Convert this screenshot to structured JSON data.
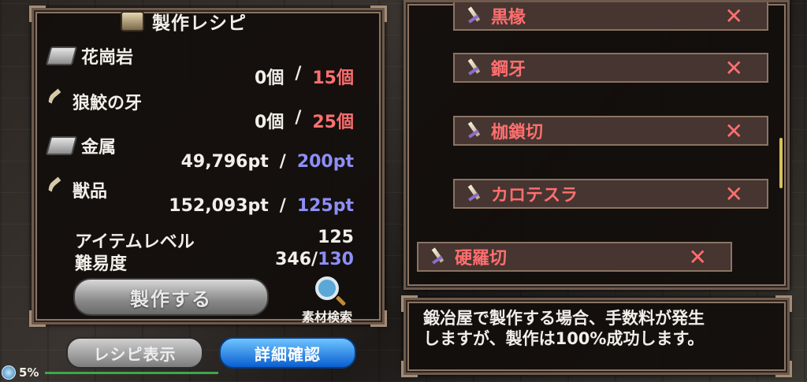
{
  "recipe": {
    "title": "製作レシピ",
    "materials": [
      {
        "name": "花崗岩",
        "icon": "ingot-icon",
        "have": "0個",
        "sep": "/",
        "need": "15個",
        "need_color": "red"
      },
      {
        "name": "狼鮫の牙",
        "icon": "fang-icon",
        "have": "0個",
        "sep": "/",
        "need": "25個",
        "need_color": "red"
      },
      {
        "name": "金属",
        "icon": "ingot-icon",
        "have": "49,796pt",
        "sep": "/",
        "need": "200pt",
        "need_color": "blue"
      },
      {
        "name": "獣品",
        "icon": "fang-icon",
        "have": "152,093pt",
        "sep": "/",
        "need": "125pt",
        "need_color": "blue"
      }
    ],
    "item_level_label": "アイテムレベル",
    "item_level_value": "125",
    "difficulty_label": "難易度",
    "difficulty_value": "346/",
    "difficulty_req": "130",
    "craft_button": "製作する",
    "search_label": "素材検索"
  },
  "bottom_buttons": {
    "recipe_display": "レシピ表示",
    "detail_confirm": "詳細確認"
  },
  "list": {
    "items": [
      {
        "name": "黒椽",
        "mark": "✕"
      },
      {
        "name": "鋼牙",
        "mark": "✕"
      },
      {
        "name": "枷鎖切",
        "mark": "✕"
      },
      {
        "name": "カロテスラ",
        "mark": "✕"
      },
      {
        "name": "硬羅切",
        "mark": "✕"
      }
    ]
  },
  "message": {
    "line1": "鍛冶屋で製作する場合、手数料が発生",
    "line2": "しますが、製作は100%成功します。"
  },
  "status": {
    "percent": "5%"
  },
  "colors": {
    "need_red": "#ff6f6f",
    "need_blue": "#8e8ef7",
    "detail_button": "#1a7be0"
  }
}
